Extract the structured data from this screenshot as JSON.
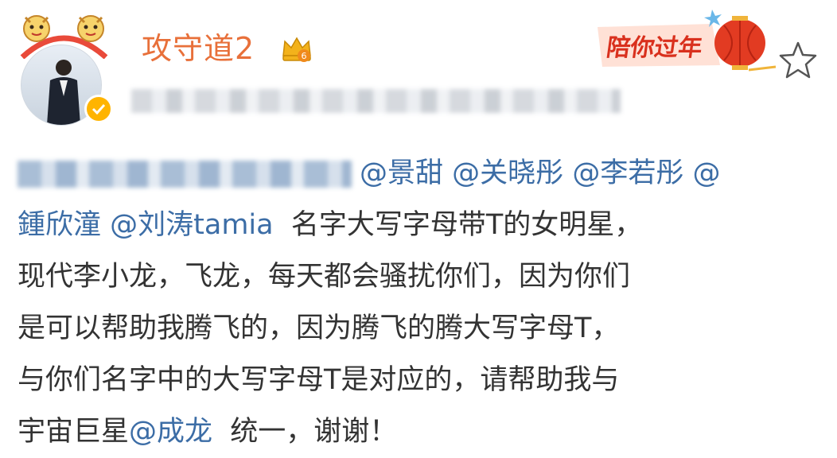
{
  "user": {
    "name": "攻守道2",
    "crown_level": "6"
  },
  "festival": {
    "text": "陪你过年"
  },
  "post": {
    "mentions_line1": [
      "@景甜",
      "@关晓彤",
      "@李若彤",
      "@"
    ],
    "line2_mentions": [
      "鍾欣潼",
      "@刘涛tamia"
    ],
    "line2_text": "名字大写字母带T的女明星，",
    "line3": "现代李小龙，飞龙，每天都会骚扰你们，因为你们",
    "line4": "是可以帮助我腾飞的，因为腾飞的腾大写字母T，",
    "line5": "与你们名字中的大写字母T是对应的，请帮助我与",
    "line6_prefix": "宇宙巨星",
    "line6_mention": "@成龙",
    "line6_suffix": "统一，谢谢！"
  },
  "colors": {
    "username": "#e8703a",
    "mention": "#3c6da6",
    "text": "#333333",
    "festival_red": "#d9301d",
    "verified": "#ffb400"
  }
}
